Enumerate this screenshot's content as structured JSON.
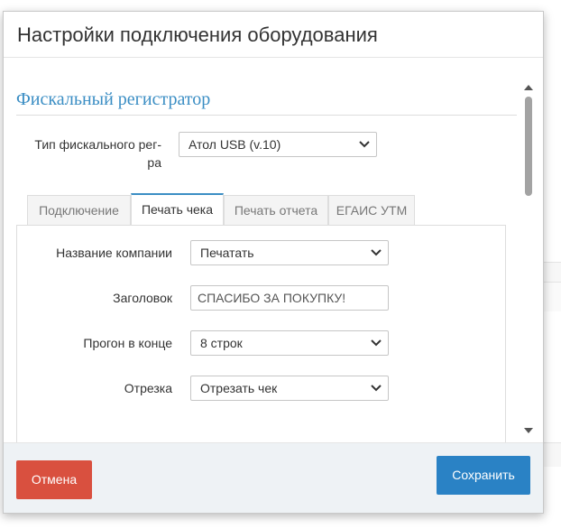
{
  "modal": {
    "title": "Настройки подключения оборудования"
  },
  "section": {
    "title": "Фискальный регистратор"
  },
  "fiscal_type": {
    "label_line1": "Тип фискального рег-",
    "label_line2": "ра",
    "value": "Атол USB (v.10)"
  },
  "tabs": [
    {
      "label": "Подключение",
      "active": false
    },
    {
      "label": "Печать чека",
      "active": true
    },
    {
      "label": "Печать отчета",
      "active": false
    },
    {
      "label": "ЕГАИС УТМ",
      "active": false
    }
  ],
  "receipt": {
    "company_name_label": "Название компании",
    "company_name_value": "Печатать",
    "header_label": "Заголовок",
    "header_value": "СПАСИБО ЗА ПОКУПКУ!",
    "feed_label": "Прогон в конце",
    "feed_value": "8 строк",
    "cut_label": "Отрезка",
    "cut_value": "Отрезать чек"
  },
  "footer": {
    "cancel_label": "Отмена",
    "save_label": "Сохранить"
  },
  "colors": {
    "section_title": "#3b8ec4",
    "cancel_button": "#d9503f",
    "save_button": "#2a82c5",
    "active_tab_border": "#3b8ec4"
  }
}
